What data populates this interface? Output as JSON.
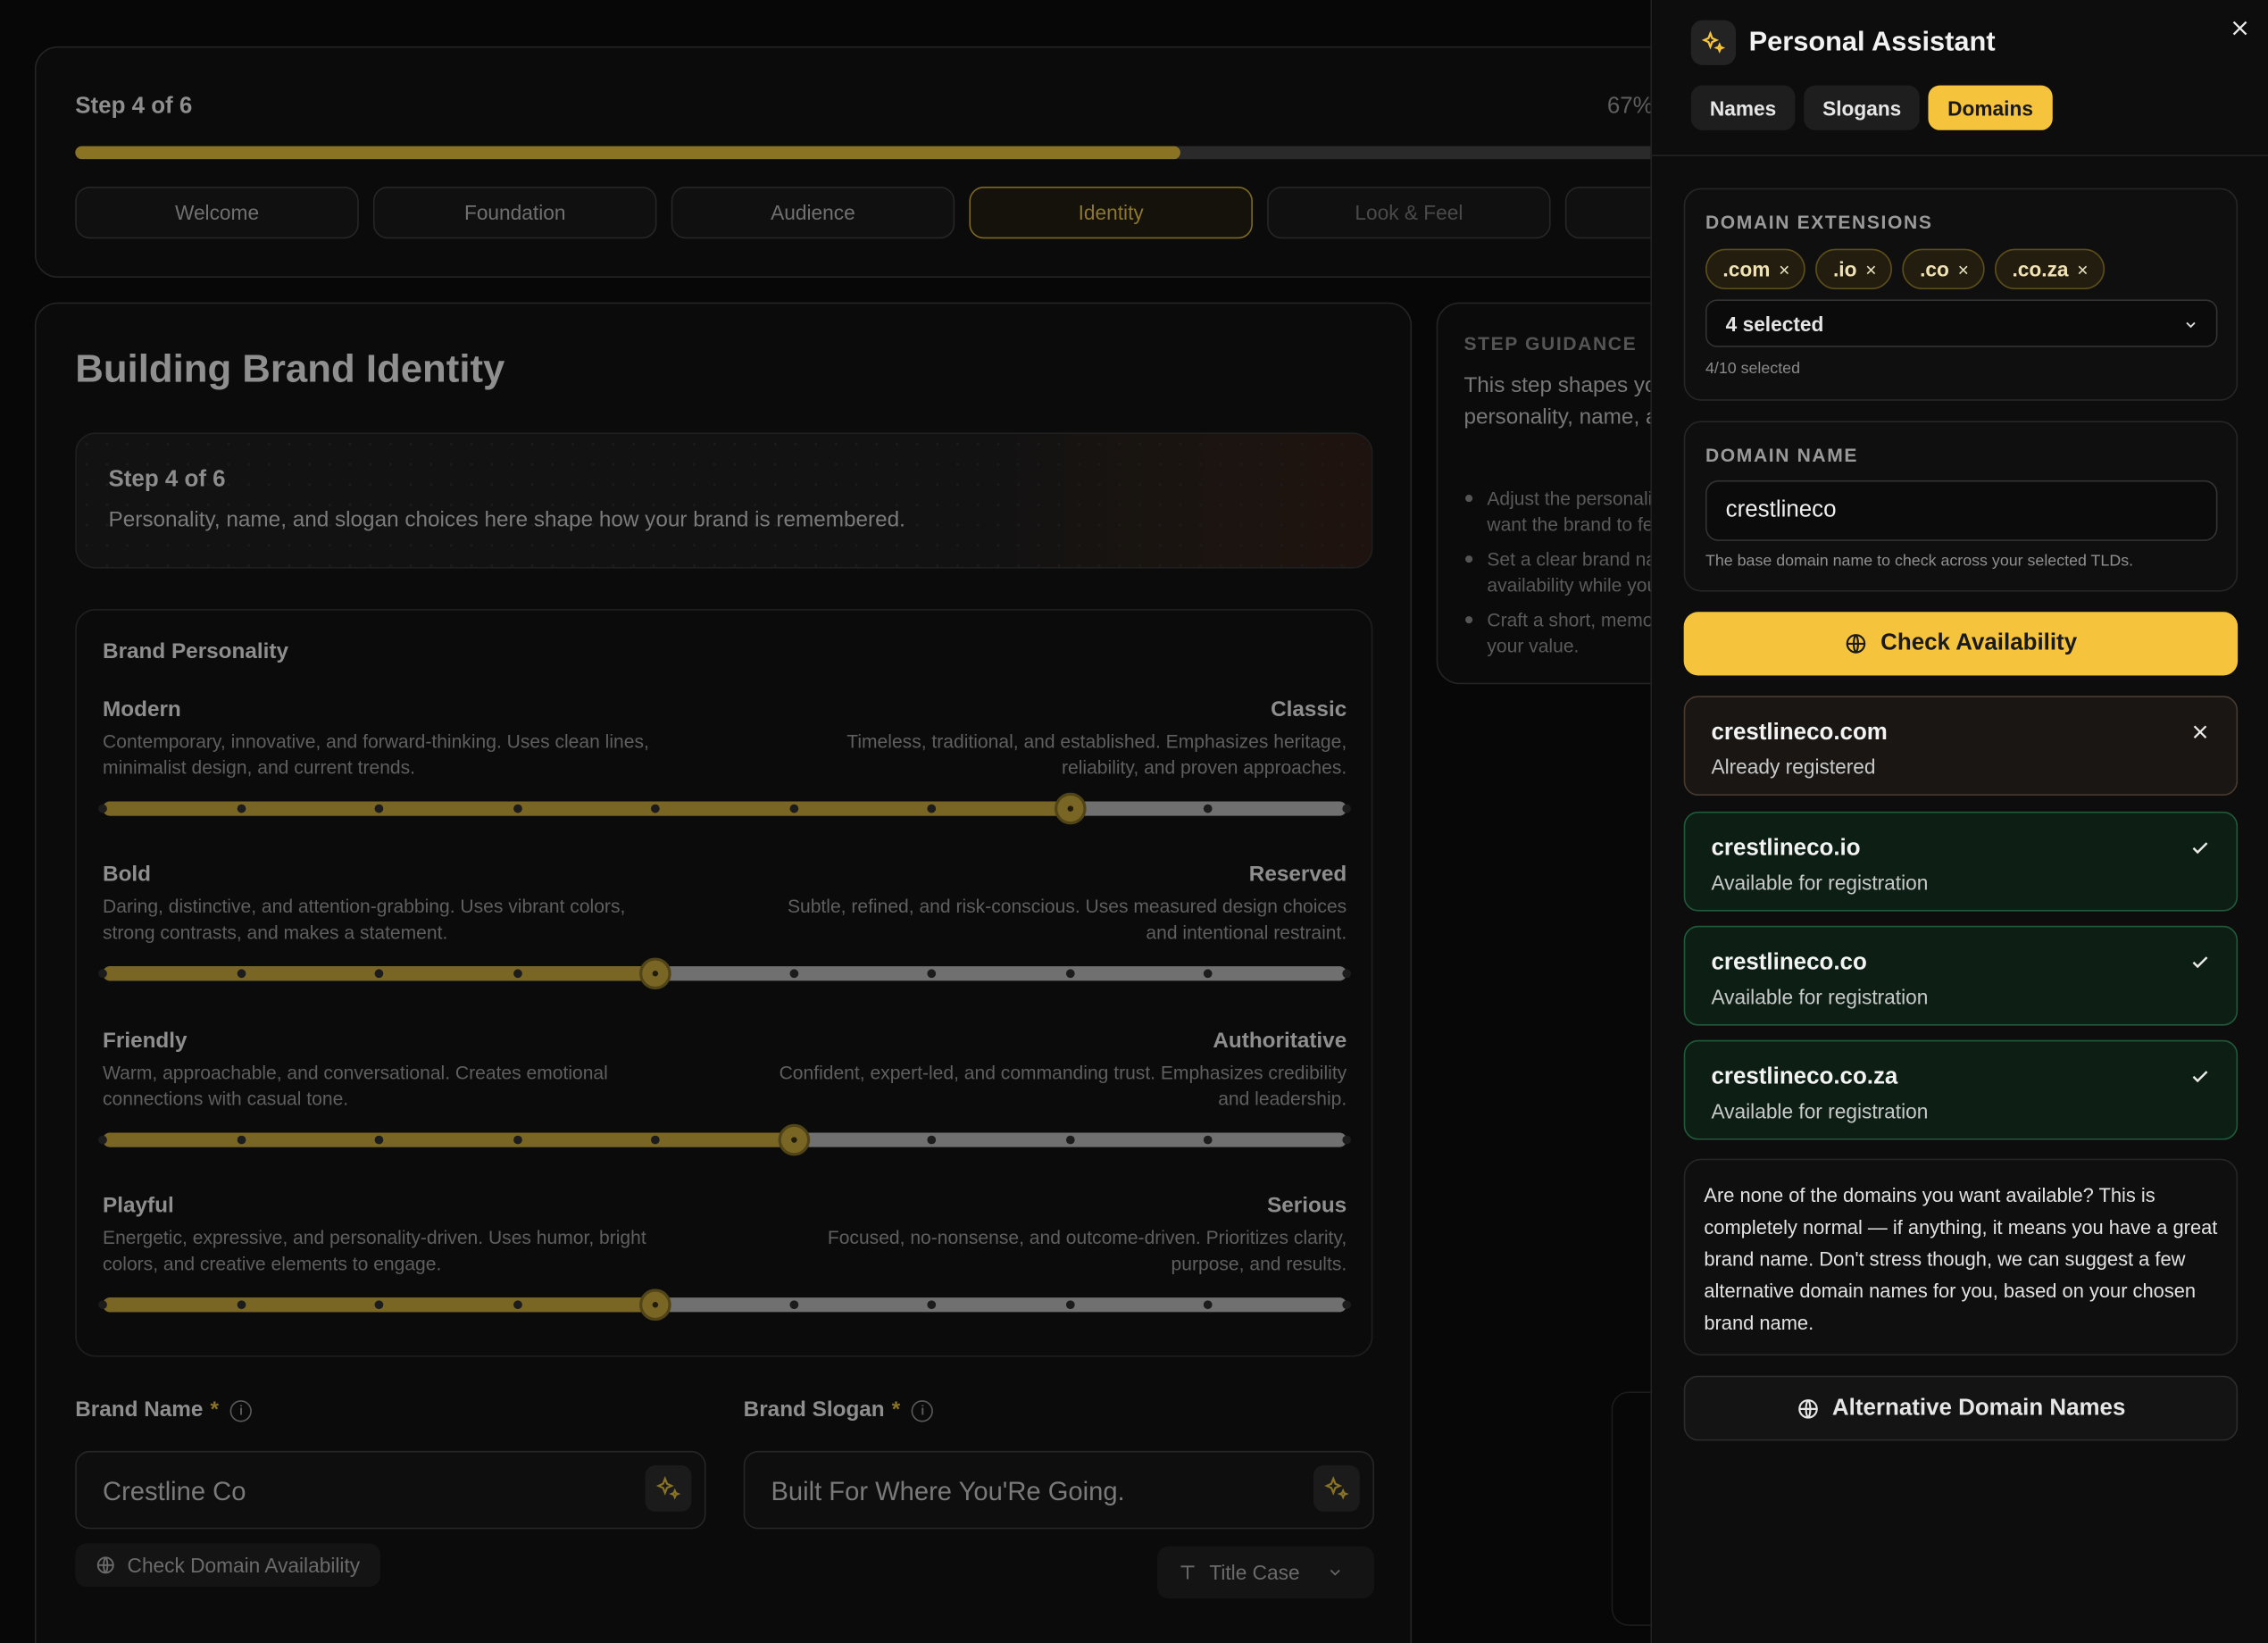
{
  "wizard": {
    "step_label": "Step 4 of 6",
    "percent_label": "67%",
    "progress": 0.67,
    "tabs": [
      "Welcome",
      "Foundation",
      "Audience",
      "Identity",
      "Look & Feel",
      ""
    ],
    "active_tab": "Identity"
  },
  "main": {
    "title": "Building Brand Identity",
    "banner_title": "Step 4 of 6",
    "banner_subtitle": "Personality, name, and slogan choices here shape how your brand is remembered.",
    "personality_title": "Brand Personality",
    "traits": [
      {
        "left": "Modern",
        "left_desc": "Contemporary, innovative, and forward-thinking. Uses clean lines, minimalist design, and current trends.",
        "right": "Classic",
        "right_desc": "Timeless, traditional, and established. Emphasizes heritage, reliability, and proven approaches.",
        "value": 7,
        "steps": 9
      },
      {
        "left": "Bold",
        "left_desc": "Daring, distinctive, and attention-grabbing. Uses vibrant colors, strong contrasts, and makes a statement.",
        "right": "Reserved",
        "right_desc": "Subtle, refined, and risk-conscious. Uses measured design choices and intentional restraint.",
        "value": 4,
        "steps": 9
      },
      {
        "left": "Friendly",
        "left_desc": "Warm, approachable, and conversational. Creates emotional connections with casual tone.",
        "right": "Authoritative",
        "right_desc": "Confident, expert-led, and commanding trust. Emphasizes credibility and leadership.",
        "value": 5,
        "steps": 9
      },
      {
        "left": "Playful",
        "left_desc": "Energetic, expressive, and personality-driven. Uses humor, bright colors, and creative elements to engage.",
        "right": "Serious",
        "right_desc": "Focused, no-nonsense, and outcome-driven. Prioritizes clarity, purpose, and results.",
        "value": 4,
        "steps": 9
      }
    ],
    "brand_name_label": "Brand Name",
    "brand_name_value": "Crestline Co",
    "brand_slogan_label": "Brand Slogan",
    "brand_slogan_value": "Built For Where You'Re Going.",
    "required_mark": "*",
    "check_domain_label": "Check Domain Availability",
    "case_select_label": "Title Case"
  },
  "guidance": {
    "heading": "STEP GUIDANCE",
    "body": "This step shapes your brand identity with personality, name, and slogan choices.",
    "bullets": [
      "Adjust the personality sliders to reflect how you want the brand to feel.",
      "Set a clear brand name and check domain availability while you decide.",
      "Craft a short, memorable slogan that reinforces your value."
    ]
  },
  "assistant": {
    "title": "Personal Assistant",
    "tabs": [
      "Names",
      "Slogans",
      "Domains"
    ],
    "active_tab": "Domains",
    "extensions_label": "DOMAIN EXTENSIONS",
    "extensions": [
      ".com",
      ".io",
      ".co",
      ".co.za"
    ],
    "remove_glyph": "×",
    "select_value": "4 selected",
    "counter": "4/10 selected",
    "domain_name_label": "DOMAIN NAME",
    "domain_name_value": "crestlineco",
    "domain_hint": "The base domain name to check across your selected TLDs.",
    "check_button": "Check Availability",
    "results": [
      {
        "domain": "crestlineco.com",
        "status": "Already registered",
        "available": false
      },
      {
        "domain": "crestlineco.io",
        "status": "Available for registration",
        "available": true
      },
      {
        "domain": "crestlineco.co",
        "status": "Available for registration",
        "available": true
      },
      {
        "domain": "crestlineco.co.za",
        "status": "Available for registration",
        "available": true
      }
    ],
    "note": "Are none of the domains you want available? This is completely normal — if anything, it means you have a great brand name. Don't stress though, we can suggest a few alternative domain names for you, based on your chosen brand name.",
    "alt_button": "Alternative Domain Names"
  },
  "colors": {
    "accent": "#f5c43c",
    "accent_dim": "#7a6624",
    "available_border": "#1f5a3a",
    "taken_border": "#4a3a2e"
  },
  "icons": [
    "sparkles-icon",
    "close-icon",
    "chevron-down-icon",
    "globe-icon",
    "check-icon",
    "x-icon",
    "info-icon",
    "text-case-icon"
  ]
}
